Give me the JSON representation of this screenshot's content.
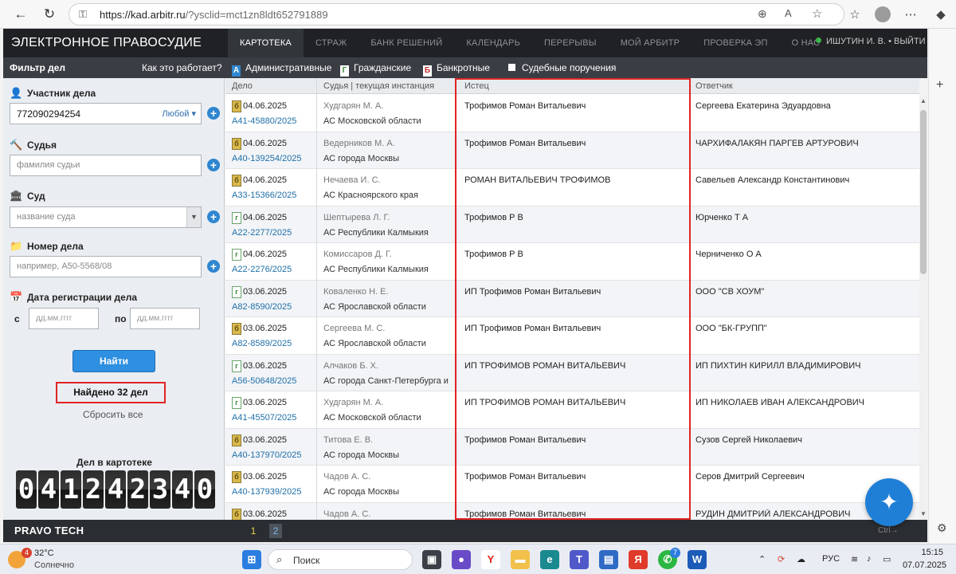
{
  "browser": {
    "url_main": "https://kad.arbitr.ru",
    "url_rest": "/?ysclid=mct1zn8ldt652791889"
  },
  "header": {
    "logo": "ЭЛЕКТРОННОЕ ПРАВОСУДИЕ",
    "nav": [
      "КАРТОТЕКА",
      "СТРАЖ",
      "БАНК РЕШЕНИЙ",
      "КАЛЕНДАРЬ",
      "ПЕРЕРЫВЫ",
      "МОЙ АРБИТР",
      "ПРОВЕРКА ЭП",
      "О НАС"
    ],
    "user": "ИШУТИН И. В.",
    "logout": "ВЫЙТИ"
  },
  "filterbar": {
    "title": "Фильтр дел",
    "howto": "Как это работает?",
    "types": [
      "Административные",
      "Гражданские",
      "Банкротные"
    ],
    "type_letters": [
      "А",
      "Г",
      "Б"
    ],
    "court_orders": "Судебные поручения"
  },
  "filter": {
    "participant_label": "Участник дела",
    "participant_value": "772090294254",
    "participant_mode": "Любой",
    "judge_label": "Судья",
    "judge_placeholder": "фамилия судьи",
    "court_label": "Суд",
    "court_placeholder": "название суда",
    "casenum_label": "Номер дела",
    "casenum_placeholder": "например, А50-5568/08",
    "date_label": "Дата регистрации дела",
    "from_label": "с",
    "to_label": "по",
    "date_placeholder": "дд.мм.гггг",
    "find_button": "Найти",
    "found": "Найдено 32 дел",
    "reset": "Сбросить все",
    "counter_label": "Дел в картотеке",
    "counter": "041242340"
  },
  "table": {
    "headers": [
      "Дело",
      "Судья | текущая инстанция",
      "Истец",
      "Ответчик"
    ],
    "rows": [
      {
        "date": "04.06.2025",
        "num": "А41-45880/2025",
        "judge": "Худгарян М. А.",
        "court": "АС Московской области",
        "plaintiff": "Трофимов Роман Витальевич",
        "defendant": "Сергеева Екатерина Эдуардовна",
        "type": "bank"
      },
      {
        "date": "04.06.2025",
        "num": "А40-139254/2025",
        "judge": "Ведерников М. А.",
        "court": "АС города Москвы",
        "plaintiff": "Трофимов Роман Витальевич",
        "defendant": "ЧАРХИФАЛАКЯН ПАРГЕВ АРТУРОВИЧ",
        "type": "bank"
      },
      {
        "date": "04.06.2025",
        "num": "А33-15366/2025",
        "judge": "Нечаева И. С.",
        "court": "АС Красноярского края",
        "plaintiff": "РОМАН ВИТАЛЬЕВИЧ ТРОФИМОВ",
        "defendant": "Савельев Александр Константинович",
        "type": "bank"
      },
      {
        "date": "04.06.2025",
        "num": "А22-2277/2025",
        "judge": "Шептырева Л. Г.",
        "court": "АС Республики Калмыкия",
        "plaintiff": "Трофимов Р В",
        "defendant": "Юрченко Т А",
        "type": "civ"
      },
      {
        "date": "04.06.2025",
        "num": "А22-2276/2025",
        "judge": "Комиссаров Д. Г.",
        "court": "АС Республики Калмыкия",
        "plaintiff": "Трофимов Р В",
        "defendant": "Черниченко О А",
        "type": "civ"
      },
      {
        "date": "03.06.2025",
        "num": "А82-8590/2025",
        "judge": "Коваленко Н. Е.",
        "court": "АС Ярославской области",
        "plaintiff": "ИП Трофимов Роман Витальевич",
        "defendant": "ООО \"СВ ХОУМ\"",
        "type": "civ"
      },
      {
        "date": "03.06.2025",
        "num": "А82-8589/2025",
        "judge": "Сергеева М. С.",
        "court": "АС Ярославской области",
        "plaintiff": "ИП Трофимов Роман Витальевич",
        "defendant": "ООО \"БК-ГРУПП\"",
        "type": "bank"
      },
      {
        "date": "03.06.2025",
        "num": "А56-50648/2025",
        "judge": "Алчаков Б. Х.",
        "court": "АС города Санкт-Петербурга и",
        "plaintiff": "ИП ТРОФИМОВ РОМАН ВИТАЛЬЕВИЧ",
        "defendant": "ИП ПИХТИН КИРИЛЛ ВЛАДИМИРОВИЧ",
        "type": "civ"
      },
      {
        "date": "03.06.2025",
        "num": "А41-45507/2025",
        "judge": "Худгарян М. А.",
        "court": "АС Московской области",
        "plaintiff": "ИП ТРОФИМОВ РОМАН ВИТАЛЬЕВИЧ",
        "defendant": "ИП НИКОЛАЕВ ИВАН АЛЕКСАНДРОВИЧ",
        "type": "civ"
      },
      {
        "date": "03.06.2025",
        "num": "А40-137970/2025",
        "judge": "Титова Е. В.",
        "court": "АС города Москвы",
        "plaintiff": "Трофимов Роман Витальевич",
        "defendant": "Сузов Сергей Николаевич",
        "type": "bank"
      },
      {
        "date": "03.06.2025",
        "num": "А40-137939/2025",
        "judge": "Чадов А. С.",
        "court": "АС города Москвы",
        "plaintiff": "Трофимов Роман Витальевич",
        "defendant": "Серов Дмитрий Сергеевич",
        "type": "bank"
      },
      {
        "date": "03.06.2025",
        "num": "",
        "judge": "Чадов А. С.",
        "court": "",
        "plaintiff": "Трофимов Роман Витальевич",
        "defendant": "РУДИН ДМИТРИЙ АЛЕКСАНДРОВИЧ",
        "type": "bank"
      }
    ]
  },
  "footer": {
    "brand": "PRAVO TECH",
    "pages": [
      "1",
      "2"
    ],
    "ctrl_hint": "Ctrl→"
  },
  "taskbar": {
    "weather_temp": "32°C",
    "weather_text": "Солнечно",
    "weather_badge": "4",
    "search": "Поиск",
    "whatsapp_badge": "7",
    "lang": "РУС",
    "time": "15:15",
    "date": "07.07.2025"
  }
}
